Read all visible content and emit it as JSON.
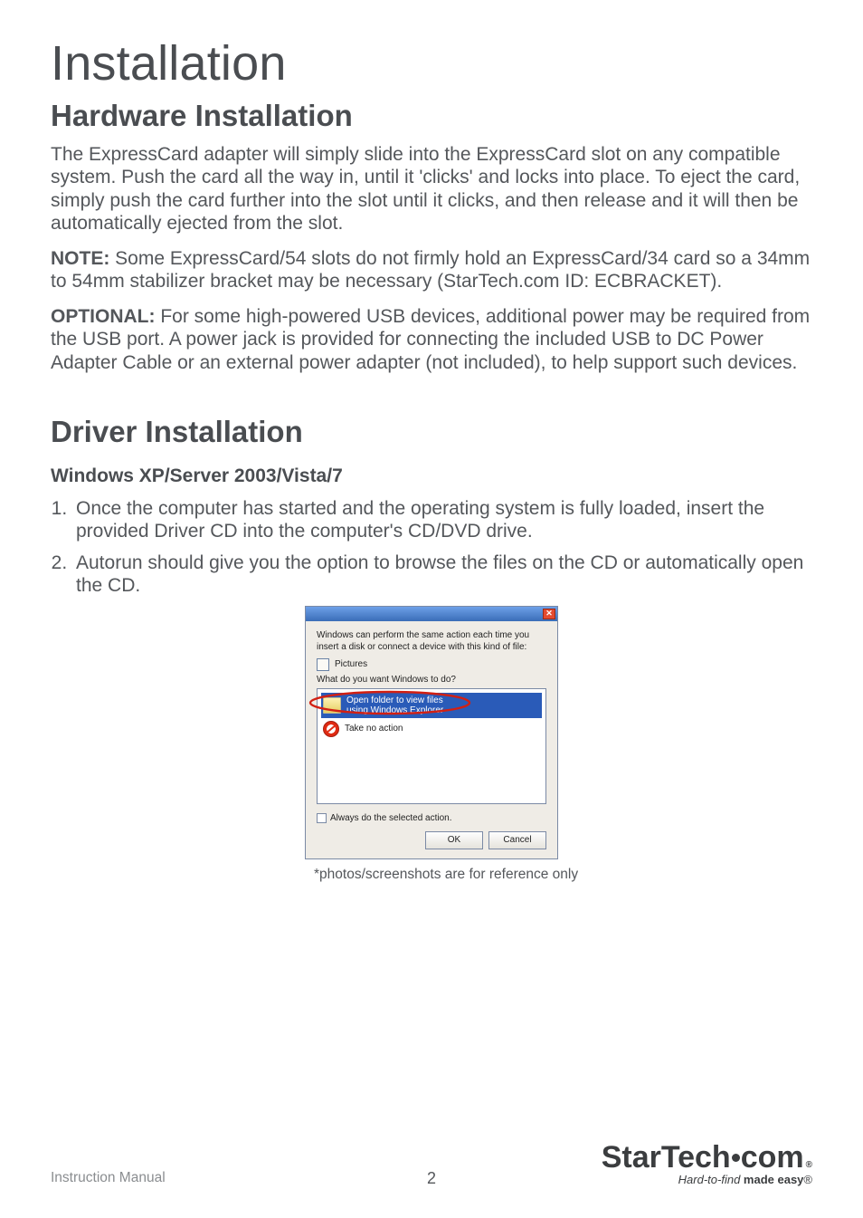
{
  "title": "Installation",
  "h2_hardware": "Hardware Installation",
  "p1": "The ExpressCard adapter will simply slide into the ExpressCard slot on any compatible system. Push the card all the way in, until it 'clicks' and locks into place. To eject the card, simply push the card further into the slot until it clicks, and then release and it will then be automatically ejected from the slot.",
  "p2_lead": "NOTE:",
  "p2": " Some ExpressCard/54 slots do not firmly hold an ExpressCard/34 card so a 34mm to 54mm stabilizer bracket may be necessary (StarTech.com ID: ECBRACKET).",
  "p3_lead": "OPTIONAL:",
  "p3": " For some high-powered USB devices, additional power may be required from the USB port. A power jack is provided for connecting the included USB to DC Power Adapter Cable or an external power adapter (not included), to help support such devices.",
  "h2_driver": "Driver Installation",
  "h3_win": "Windows XP/Server 2003/Vista/7",
  "ol": {
    "i1": "Once the computer has started and the operating system is fully loaded, insert the provided Driver CD into the computer's CD/DVD drive.",
    "i2": "Autorun should give you the option to browse the files on the CD or automatically open the CD."
  },
  "dialog": {
    "msg": "Windows can perform the same action each time you insert a disk or connect a device with this kind of file:",
    "media_label": "Pictures",
    "legend": "What do you want Windows to do?",
    "item1_line1": "Open folder to view files",
    "item1_line2": "using Windows Explorer",
    "item2": "Take no action",
    "checkbox": "Always do the selected action.",
    "ok": "OK",
    "cancel": "Cancel",
    "close_x": "✕"
  },
  "caption": "*photos/screenshots are for reference only",
  "footer": {
    "left": "Instruction Manual",
    "page": "2",
    "logo_main_a": "StarTech",
    "logo_main_b": "com",
    "logo_reg": "®",
    "logo_tag_a": "Hard-to-find ",
    "logo_tag_b": "made easy",
    "logo_tag_reg": "®"
  }
}
